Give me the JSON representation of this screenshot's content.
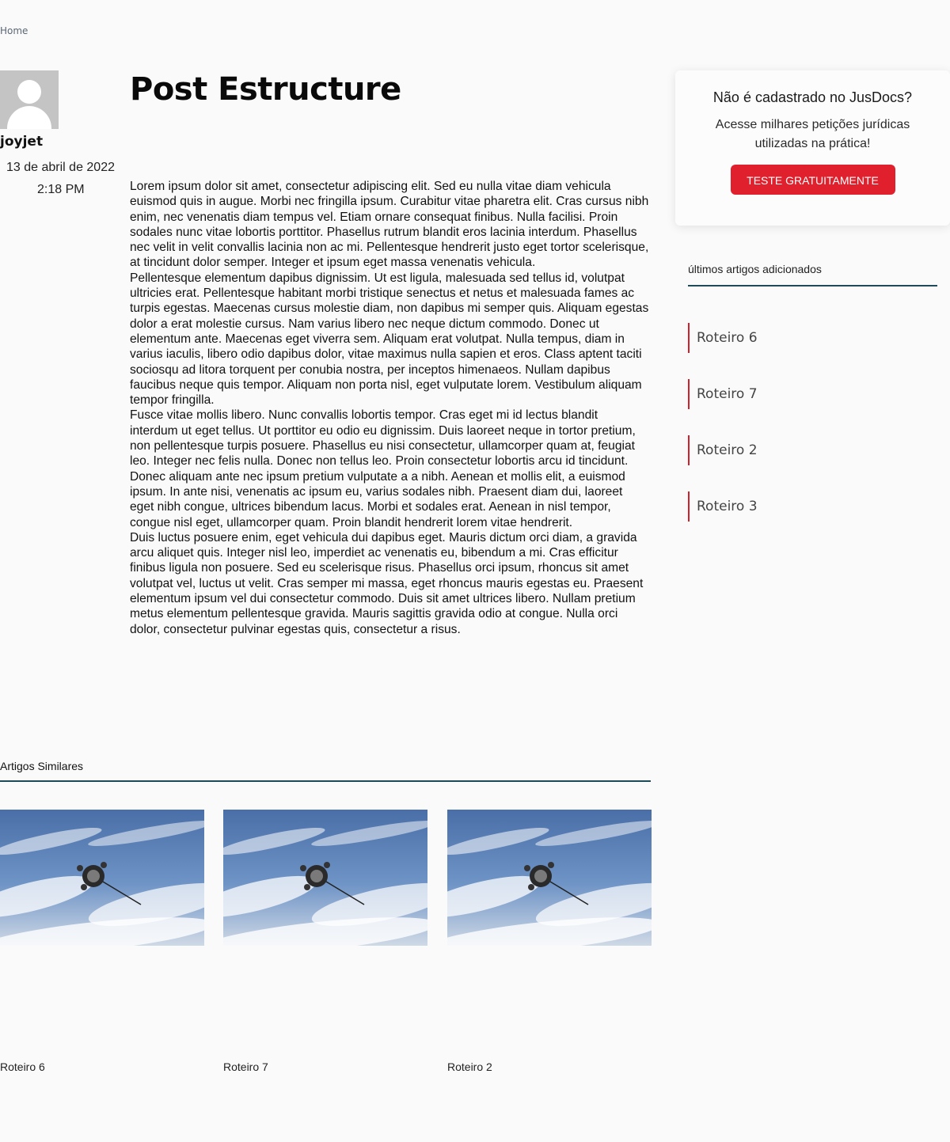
{
  "breadcrumb": {
    "home": "Home"
  },
  "author": {
    "name": "joyjet",
    "date": "13 de abril de 2022",
    "time": "2:18 PM"
  },
  "post": {
    "title": "Post Estructure",
    "paragraphs": [
      "Lorem ipsum dolor sit amet, consectetur adipiscing elit. Sed eu nulla vitae diam vehicula euismod quis in augue. Morbi nec fringilla ipsum. Curabitur vitae pharetra elit. Cras cursus nibh enim, nec venenatis diam tempus vel. Etiam ornare consequat finibus. Nulla facilisi. Proin sodales nunc vitae lobortis porttitor. Phasellus rutrum blandit eros lacinia interdum. Phasellus nec velit in velit convallis lacinia non ac mi. Pellentesque hendrerit justo eget tortor scelerisque, at tincidunt dolor semper. Integer et ipsum eget massa venenatis vehicula.",
      "Pellentesque elementum dapibus dignissim. Ut est ligula, malesuada sed tellus id, volutpat ultricies erat. Pellentesque habitant morbi tristique senectus et netus et malesuada fames ac turpis egestas. Maecenas cursus molestie diam, non dapibus mi semper quis. Aliquam egestas dolor a erat molestie cursus. Nam varius libero nec neque dictum commodo. Donec ut elementum ante. Maecenas eget viverra sem. Aliquam erat volutpat. Nulla tempus, diam in varius iaculis, libero odio dapibus dolor, vitae maximus nulla sapien et eros. Class aptent taciti sociosqu ad litora torquent per conubia nostra, per inceptos himenaeos. Nullam dapibus faucibus neque quis tempor. Aliquam non porta nisl, eget vulputate lorem. Vestibulum aliquam tempor fringilla.",
      "Fusce vitae mollis libero. Nunc convallis lobortis tempor. Cras eget mi id lectus blandit interdum ut eget tellus. Ut porttitor eu odio eu dignissim. Duis laoreet neque in tortor pretium, non pellentesque turpis posuere. Phasellus eu nisi consectetur, ullamcorper quam at, feugiat leo. Integer nec felis nulla. Donec non tellus leo. Proin consectetur lobortis arcu id tincidunt.",
      "Donec aliquam ante nec ipsum pretium vulputate a a nibh. Aenean et mollis elit, a euismod ipsum. In ante nisi, venenatis ac ipsum eu, varius sodales nibh. Praesent diam dui, laoreet eget nibh congue, ultrices bibendum lacus. Morbi et sodales erat. Aenean in nisl tempor, congue nisl eget, ullamcorper quam. Proin blandit hendrerit lorem vitae hendrerit.",
      "Duis luctus posuere enim, eget vehicula dui dapibus eget. Mauris dictum orci diam, a gravida arcu aliquet quis. Integer nisl leo, imperdiet ac venenatis eu, bibendum a mi. Cras efficitur finibus ligula non posuere. Sed eu scelerisque risus. Phasellus orci ipsum, rhoncus sit amet volutpat vel, luctus ut velit. Cras semper mi massa, eget rhoncus mauris egestas eu. Praesent elementum ipsum vel dui consectetur commodo. Duis sit amet ultrices libero. Nullam pretium metus elementum pellentesque gravida. Mauris sagittis gravida odio at congue. Nulla orci dolor, consectetur pulvinar egestas quis, consectetur a risus."
    ]
  },
  "cta": {
    "title": "Não é cadastrado no JusDocs?",
    "text": "Acesse milhares petições jurídicas utilizadas na prática!",
    "button": "TESTE GRATUITAMENTE",
    "button_color": "#e0202c"
  },
  "recent": {
    "heading": "últimos artigos adicionados",
    "items": [
      "Roteiro 6",
      "Roteiro 7",
      "Roteiro 2",
      "Roteiro 3"
    ]
  },
  "similar": {
    "heading": "Artigos Similares",
    "items": [
      {
        "label": "Roteiro 6",
        "image": "satellite-over-earth"
      },
      {
        "label": "Roteiro 7",
        "image": "satellite-over-earth"
      },
      {
        "label": "Roteiro 2",
        "image": "satellite-over-earth"
      }
    ]
  },
  "colors": {
    "accent_red": "#d11f2b",
    "divider_teal": "#1e4a5a",
    "background": "#fafafa"
  }
}
